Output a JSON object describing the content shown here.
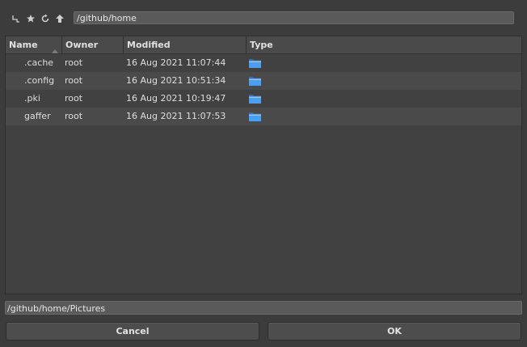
{
  "toolbar": {
    "icons": [
      "up-level-icon",
      "bookmark-star-icon",
      "refresh-icon",
      "go-up-arrow-icon"
    ],
    "path": "/github/home"
  },
  "table": {
    "columns": [
      "Name",
      "Owner",
      "Modified",
      "Type"
    ],
    "sorted_column": "Name",
    "rows": [
      {
        "name": ".cache",
        "owner": "root",
        "modified": "16 Aug 2021 11:07:44",
        "type": "folder-icon"
      },
      {
        "name": ".config",
        "owner": "root",
        "modified": "16 Aug 2021 10:51:34",
        "type": "folder-icon"
      },
      {
        "name": ".pki",
        "owner": "root",
        "modified": "16 Aug 2021 10:19:47",
        "type": "folder-icon"
      },
      {
        "name": "gaffer",
        "owner": "root",
        "modified": "16 Aug 2021 11:07:53",
        "type": "folder-icon"
      }
    ]
  },
  "selection_path": "/github/home/Pictures",
  "buttons": {
    "cancel": "Cancel",
    "ok": "OK"
  },
  "colors": {
    "background": "#3c3c3c",
    "folder": "#3a8ee6"
  }
}
